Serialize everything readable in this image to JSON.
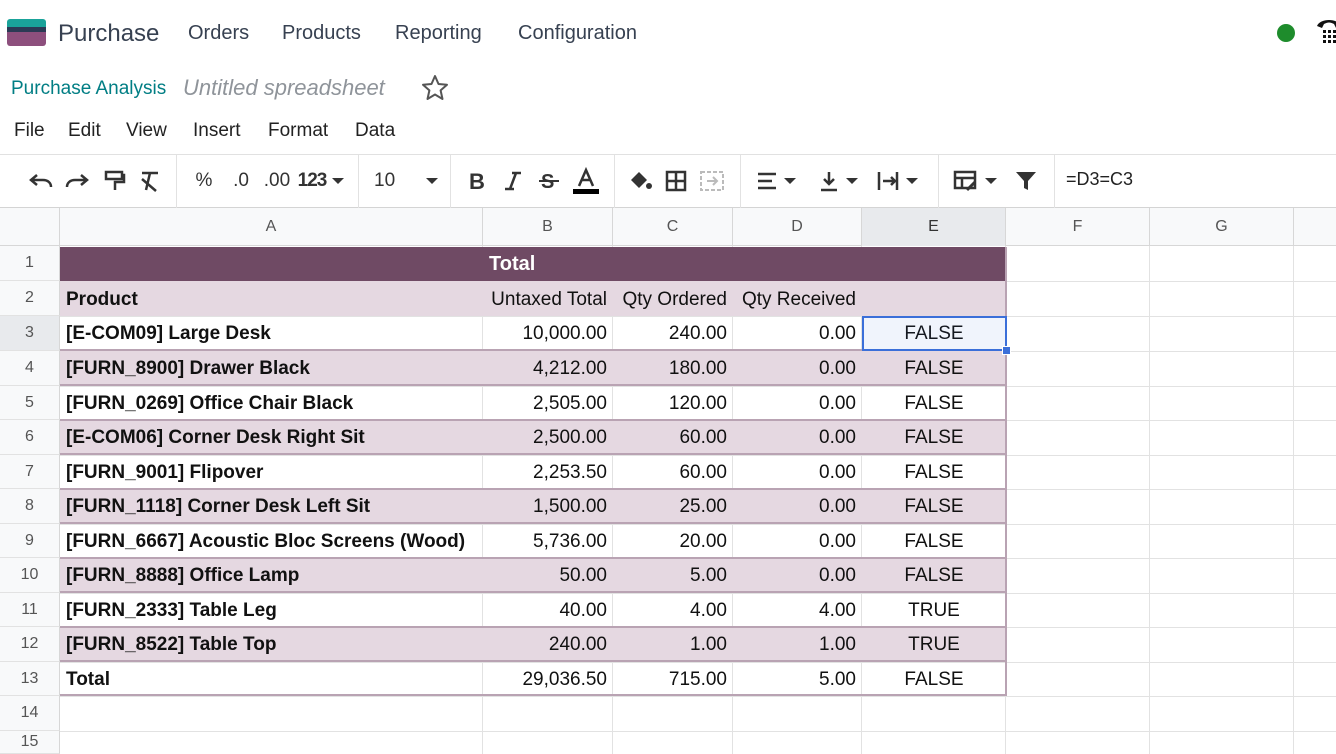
{
  "navbar": {
    "app_name": "Purchase",
    "items": [
      "Orders",
      "Products",
      "Reporting",
      "Configuration"
    ]
  },
  "breadcrumb": {
    "link": "Purchase Analysis",
    "title": "Untitled spreadsheet"
  },
  "menu": [
    "File",
    "Edit",
    "View",
    "Insert",
    "Format",
    "Data"
  ],
  "toolbar": {
    "percent": "%",
    "dec_decrease": ".0",
    "dec_increase": ".00",
    "number_format": "123",
    "font_size": "10",
    "formula": "=D3=C3"
  },
  "columns": [
    "A",
    "B",
    "C",
    "D",
    "E",
    "F",
    "G"
  ],
  "rows": [
    "1",
    "2",
    "3",
    "4",
    "5",
    "6",
    "7",
    "8",
    "9",
    "10",
    "11",
    "12",
    "13",
    "14",
    "15"
  ],
  "sheet": {
    "header_total": "Total",
    "headers": [
      "Product",
      "Untaxed Total",
      "Qty Ordered",
      "Qty Received"
    ],
    "data": [
      [
        "[E-COM09] Large Desk",
        "10,000.00",
        "240.00",
        "0.00",
        "FALSE"
      ],
      [
        "[FURN_8900] Drawer Black",
        "4,212.00",
        "180.00",
        "0.00",
        "FALSE"
      ],
      [
        "[FURN_0269] Office Chair Black",
        "2,505.00",
        "120.00",
        "0.00",
        "FALSE"
      ],
      [
        "[E-COM06] Corner Desk Right Sit",
        "2,500.00",
        "60.00",
        "0.00",
        "FALSE"
      ],
      [
        "[FURN_9001] Flipover",
        "2,253.50",
        "60.00",
        "0.00",
        "FALSE"
      ],
      [
        "[FURN_1118] Corner Desk Left Sit",
        "1,500.00",
        "25.00",
        "0.00",
        "FALSE"
      ],
      [
        "[FURN_6667] Acoustic Bloc Screens (Wood)",
        "5,736.00",
        "20.00",
        "0.00",
        "FALSE"
      ],
      [
        "[FURN_8888] Office Lamp",
        "50.00",
        "5.00",
        "0.00",
        "FALSE"
      ],
      [
        "[FURN_2333] Table Leg",
        "40.00",
        "4.00",
        "4.00",
        "TRUE"
      ],
      [
        "[FURN_8522] Table Top",
        "240.00",
        "1.00",
        "1.00",
        "TRUE"
      ]
    ],
    "total_row": [
      "Total",
      "29,036.50",
      "715.00",
      "5.00",
      "FALSE"
    ]
  },
  "colors": {
    "header_band": "#6f4a64",
    "row_band": "#e5d8e1",
    "accent_link": "#017e84",
    "status_online": "#1e8c2c",
    "selection": "#3b6fd9"
  }
}
